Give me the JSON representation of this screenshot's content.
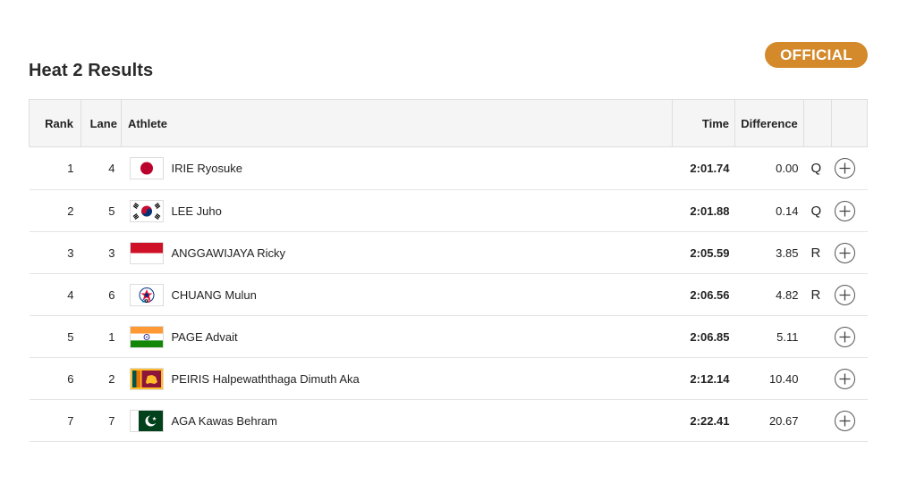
{
  "title": "Heat 2 Results",
  "status_badge": "OFFICIAL",
  "columns": {
    "rank": "Rank",
    "lane": "Lane",
    "athlete": "Athlete",
    "time": "Time",
    "difference": "Difference"
  },
  "rows": [
    {
      "rank": "1",
      "lane": "4",
      "country_flag": "japan-flag",
      "athlete": "IRIE Ryosuke",
      "time": "2:01.74",
      "difference": "0.00",
      "qualifier": "Q"
    },
    {
      "rank": "2",
      "lane": "5",
      "country_flag": "korea-flag",
      "athlete": "LEE Juho",
      "time": "2:01.88",
      "difference": "0.14",
      "qualifier": "Q"
    },
    {
      "rank": "3",
      "lane": "3",
      "country_flag": "indonesia-flag",
      "athlete": "ANGGAWIJAYA Ricky",
      "time": "2:05.59",
      "difference": "3.85",
      "qualifier": "R"
    },
    {
      "rank": "4",
      "lane": "6",
      "country_flag": "chinese-taipei-flag",
      "athlete": "CHUANG Mulun",
      "time": "2:06.56",
      "difference": "4.82",
      "qualifier": "R"
    },
    {
      "rank": "5",
      "lane": "1",
      "country_flag": "india-flag",
      "athlete": "PAGE Advait",
      "time": "2:06.85",
      "difference": "5.11",
      "qualifier": ""
    },
    {
      "rank": "6",
      "lane": "2",
      "country_flag": "sri-lanka-flag",
      "athlete": "PEIRIS Halpewaththaga Dimuth Aka",
      "time": "2:12.14",
      "difference": "10.40",
      "qualifier": ""
    },
    {
      "rank": "7",
      "lane": "7",
      "country_flag": "pakistan-flag",
      "athlete": "AGA Kawas Behram",
      "time": "2:22.41",
      "difference": "20.67",
      "qualifier": ""
    }
  ],
  "icons": {
    "expand": "plus-circle-icon"
  },
  "colors": {
    "badge_bg": "#d4892b",
    "header_bg": "#f5f5f5"
  }
}
